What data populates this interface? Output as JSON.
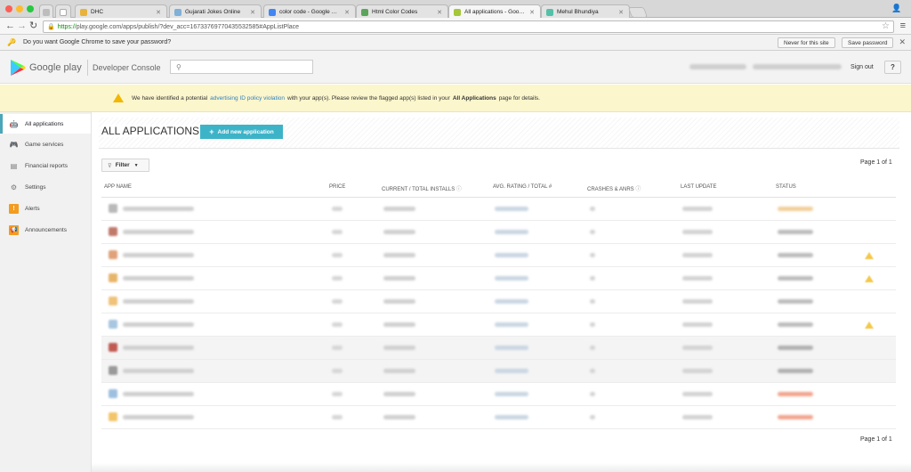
{
  "browser": {
    "tabs": [
      {
        "label": "",
        "color": "#bdbdbd"
      },
      {
        "label": "",
        "color": "#e0e0e0"
      },
      {
        "label": "DHC",
        "color": "#e8b33c"
      },
      {
        "label": "Gujarati Jokes Online",
        "color": "#7fb0d8"
      },
      {
        "label": "color code - Google Searc",
        "color": "#4285f4"
      },
      {
        "label": "Html Color Codes",
        "color": "#5ba55b"
      },
      {
        "label": "All applications - Google P",
        "color": "#a4c639"
      },
      {
        "label": "Mehul Bhundiya",
        "color": "#53c1a8"
      }
    ],
    "url_https": "https://",
    "url_rest": "play.google.com/apps/publish/?dev_acc=16733769770435532585#AppListPlace"
  },
  "password_bar": {
    "message": "Do you want Google Chrome to save your password?",
    "never_label": "Never for this site",
    "save_label": "Save password"
  },
  "header": {
    "brand": "Google play",
    "console": "Developer Console",
    "signout": "Sign out",
    "help": "?"
  },
  "warning": {
    "text_before": "We have identified a potential",
    "link": "advertising ID policy violation",
    "text_middle": "with your app(s). Please review the flagged app(s) listed in your",
    "bold": "All Applications",
    "text_after": "page for details."
  },
  "sidebar": {
    "items": [
      {
        "label": "All applications",
        "icon": "android-icon"
      },
      {
        "label": "Game services",
        "icon": "gamepad-icon"
      },
      {
        "label": "Financial reports",
        "icon": "reports-icon"
      },
      {
        "label": "Settings",
        "icon": "gear-icon"
      },
      {
        "label": "Alerts",
        "icon": "alert-icon"
      },
      {
        "label": "Announcements",
        "icon": "megaphone-icon"
      }
    ]
  },
  "main": {
    "title": "ALL APPLICATIONS",
    "add_button": "Add new application",
    "filter": "Filter",
    "page_top": "Page 1 of 1",
    "page_bottom": "Page 1 of 1",
    "columns": {
      "app_name": "APP NAME",
      "price": "PRICE",
      "installs": "CURRENT / TOTAL INSTALLS",
      "rating": "AVG. RATING / TOTAL #",
      "crashes": "CRASHES & ANRS",
      "update": "LAST UPDATE",
      "status": "STATUS"
    },
    "rows": [
      {
        "icon_color": "#b9b9b9",
        "status_color": "#f3cf9a",
        "warn": false
      },
      {
        "icon_color": "#c07a6a",
        "status_color": "#bdbdbd",
        "warn": false
      },
      {
        "icon_color": "#e0a27a",
        "status_color": "#bdbdbd",
        "warn": true
      },
      {
        "icon_color": "#e7b56a",
        "status_color": "#bdbdbd",
        "warn": true
      },
      {
        "icon_color": "#f0c27a",
        "status_color": "#bdbdbd",
        "warn": false
      },
      {
        "icon_color": "#a8c6e0",
        "status_color": "#bdbdbd",
        "warn": true
      },
      {
        "icon_color": "#c05a50",
        "status_color": "#b0b0b0",
        "warn": false
      },
      {
        "icon_color": "#9a9a9a",
        "status_color": "#b0b0b0",
        "warn": false
      },
      {
        "icon_color": "#9ec0e0",
        "status_color": "#f2a48e",
        "warn": false
      },
      {
        "icon_color": "#f3c56a",
        "status_color": "#f2a48e",
        "warn": false
      }
    ]
  }
}
